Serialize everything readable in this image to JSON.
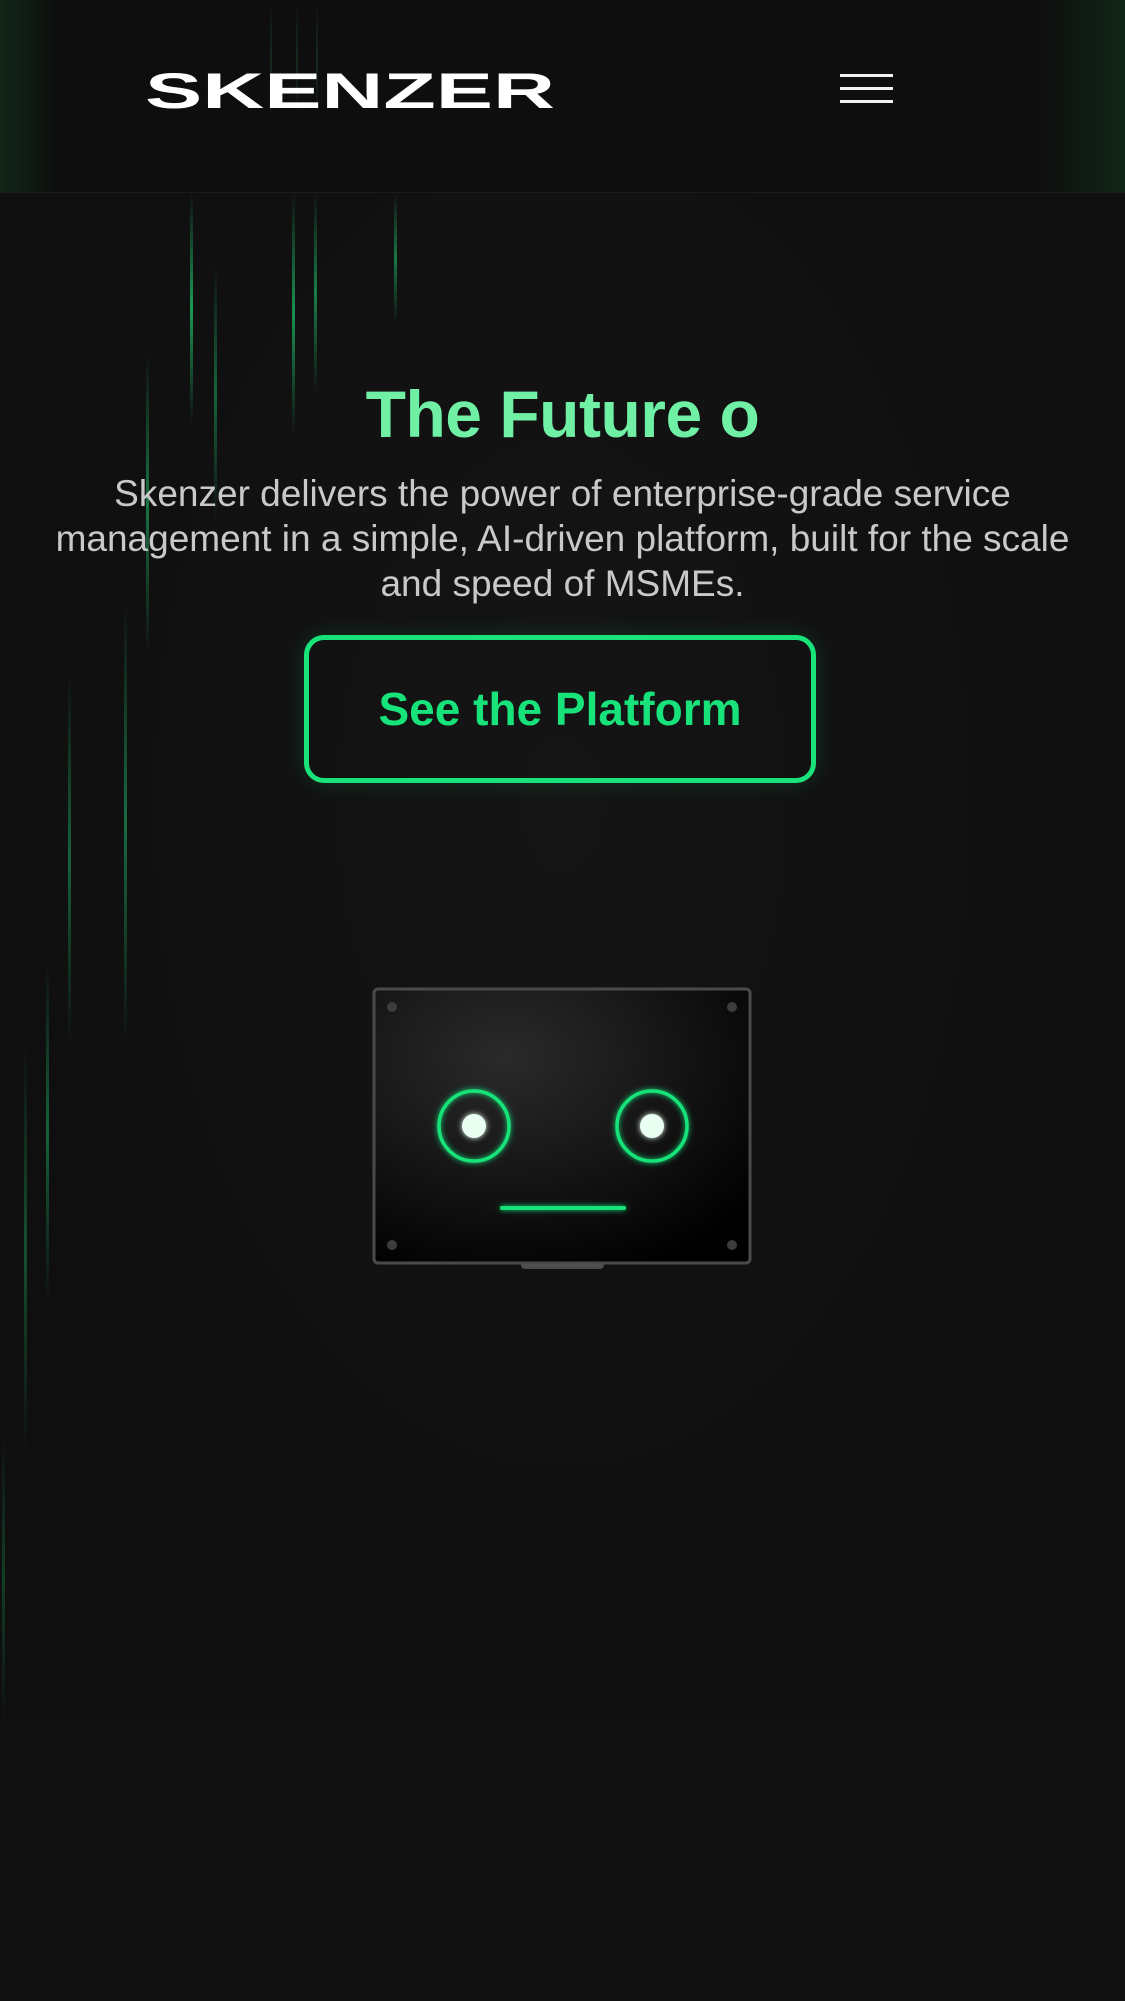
{
  "brand": {
    "logo_text": "SKENZER",
    "accent_color": "#17e37a",
    "title_color": "#6ff0a5"
  },
  "header": {
    "menu_icon": "hamburger-menu-icon"
  },
  "hero": {
    "title": "The Future o",
    "subtitle": "Skenzer delivers the power of enterprise-grade service management in a simple, AI-driven platform, built for the scale and speed of MSMEs.",
    "cta_label": "See the Platform"
  },
  "illustration": {
    "icon": "robot-face-screen-icon"
  }
}
